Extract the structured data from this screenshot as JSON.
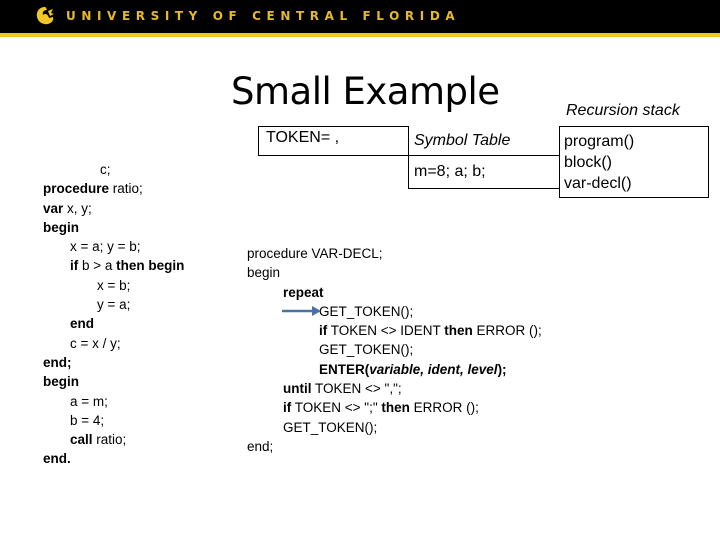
{
  "header": {
    "university_name": "UNIVERSITY OF CENTRAL FLORIDA",
    "logo_icon": "pegasus-logo-icon",
    "colors": {
      "banner": "#000000",
      "gold": "#f2c624"
    }
  },
  "slide": {
    "title": "Small Example",
    "token_box": "TOKEN= ,",
    "symbol_table": {
      "label": "Symbol Table",
      "value": "m=8; a; b;"
    },
    "recursion_stack": {
      "label": "Recursion stack",
      "items": [
        "program()",
        "block()",
        "var-decl()"
      ]
    }
  },
  "left_code": [
    {
      "indent": 4,
      "parts": [
        {
          "t": "c;",
          "b": false
        }
      ]
    },
    {
      "indent": 0,
      "parts": [
        {
          "t": "procedure",
          "b": true
        },
        {
          "t": " ratio;",
          "b": false
        }
      ]
    },
    {
      "indent": 0,
      "parts": [
        {
          "t": "var",
          "b": true
        },
        {
          "t": " x, y;",
          "b": false
        }
      ]
    },
    {
      "indent": 0,
      "parts": [
        {
          "t": "begin",
          "b": true
        }
      ]
    },
    {
      "indent": 1,
      "parts": [
        {
          "t": "x = a; y = b;",
          "b": false
        }
      ]
    },
    {
      "indent": 1,
      "parts": [
        {
          "t": "if",
          "b": true
        },
        {
          "t": " b > a ",
          "b": false
        },
        {
          "t": "then begin",
          "b": true
        }
      ]
    },
    {
      "indent": 2,
      "parts": [
        {
          "t": "x = b;",
          "b": false
        }
      ]
    },
    {
      "indent": 2,
      "parts": [
        {
          "t": "y = a;",
          "b": false
        }
      ]
    },
    {
      "indent": 1,
      "parts": [
        {
          "t": "end",
          "b": true
        }
      ]
    },
    {
      "indent": 1,
      "parts": [
        {
          "t": "c = x / y;",
          "b": false
        }
      ]
    },
    {
      "indent": 0,
      "parts": [
        {
          "t": "end;",
          "b": true
        }
      ]
    },
    {
      "indent": 0,
      "parts": [
        {
          "t": "begin",
          "b": true
        }
      ]
    },
    {
      "indent": 1,
      "parts": [
        {
          "t": "a = m;",
          "b": false
        }
      ]
    },
    {
      "indent": 1,
      "parts": [
        {
          "t": "b = 4;",
          "b": false
        }
      ]
    },
    {
      "indent": 1,
      "parts": [
        {
          "t": "call",
          "b": true
        },
        {
          "t": " ratio;",
          "b": false
        }
      ]
    },
    {
      "indent": 0,
      "parts": [
        {
          "t": "end.",
          "b": true
        }
      ]
    }
  ],
  "right_code": [
    {
      "indent": 0,
      "parts": [
        {
          "t": "procedure",
          "b": false
        },
        {
          "t": " VAR-DECL;",
          "b": false
        }
      ]
    },
    {
      "indent": 0,
      "parts": [
        {
          "t": "begin",
          "b": false
        }
      ]
    },
    {
      "indent": 1,
      "parts": [
        {
          "t": "repeat",
          "b": true
        }
      ]
    },
    {
      "indent": 2,
      "parts": [
        {
          "t": "GET_TOKEN();",
          "b": false
        }
      ],
      "current": true
    },
    {
      "indent": 2,
      "parts": [
        {
          "t": "if",
          "b": true
        },
        {
          "t": " TOKEN <> IDENT ",
          "b": false
        },
        {
          "t": "then",
          "b": true
        },
        {
          "t": " ERROR ();",
          "b": false
        }
      ]
    },
    {
      "indent": 2,
      "parts": [
        {
          "t": "GET_TOKEN();",
          "b": false
        }
      ]
    },
    {
      "indent": 2,
      "parts": [
        {
          "t": "ENTER(",
          "b": true
        },
        {
          "t": "variable, ident, level",
          "b": true,
          "i": true
        },
        {
          "t": ");",
          "b": true
        }
      ]
    },
    {
      "indent": 1,
      "parts": [
        {
          "t": "until",
          "b": true
        },
        {
          "t": " TOKEN <> \",\";",
          "b": false
        }
      ]
    },
    {
      "indent": 1,
      "parts": [
        {
          "t": "if",
          "b": true
        },
        {
          "t": " TOKEN <> \";\" ",
          "b": false
        },
        {
          "t": "then",
          "b": true
        },
        {
          "t": " ERROR ();",
          "b": false
        }
      ]
    },
    {
      "indent": 1,
      "parts": [
        {
          "t": "GET_TOKEN();",
          "b": false
        }
      ]
    },
    {
      "indent": 0,
      "parts": [
        {
          "t": "end;",
          "b": false
        }
      ]
    }
  ],
  "current_line_marker": {
    "icon": "arrow-right-icon",
    "color": "#4a72a8"
  }
}
